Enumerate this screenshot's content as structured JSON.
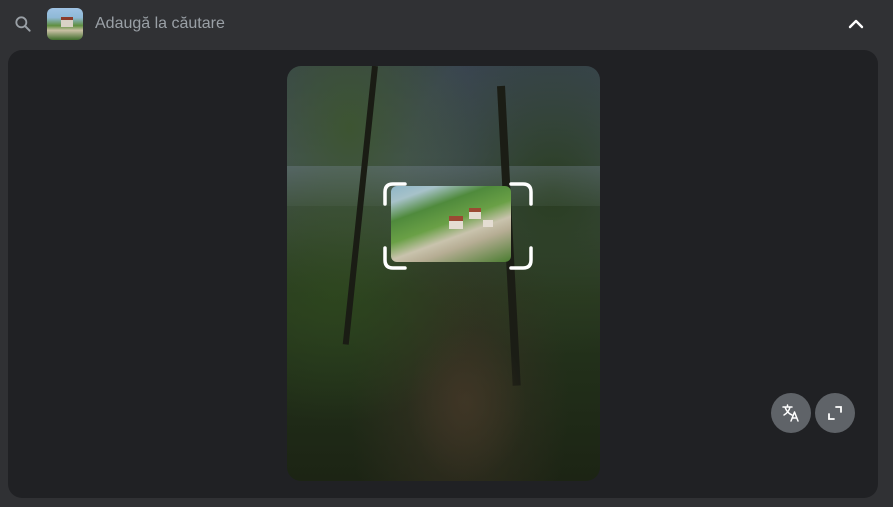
{
  "search": {
    "placeholder": "Adaugă la căutare"
  },
  "icons": {
    "search": "search-icon",
    "thumbnail": "image-thumbnail",
    "collapse": "chevron-up-icon",
    "translate": "translate-icon",
    "expand": "expand-icon"
  },
  "colors": {
    "topbar_bg": "#303134",
    "panel_bg": "#202124",
    "text_secondary": "#9aa0a6",
    "fab_bg": "#5f6368",
    "selection_corners": "#ffffff"
  }
}
